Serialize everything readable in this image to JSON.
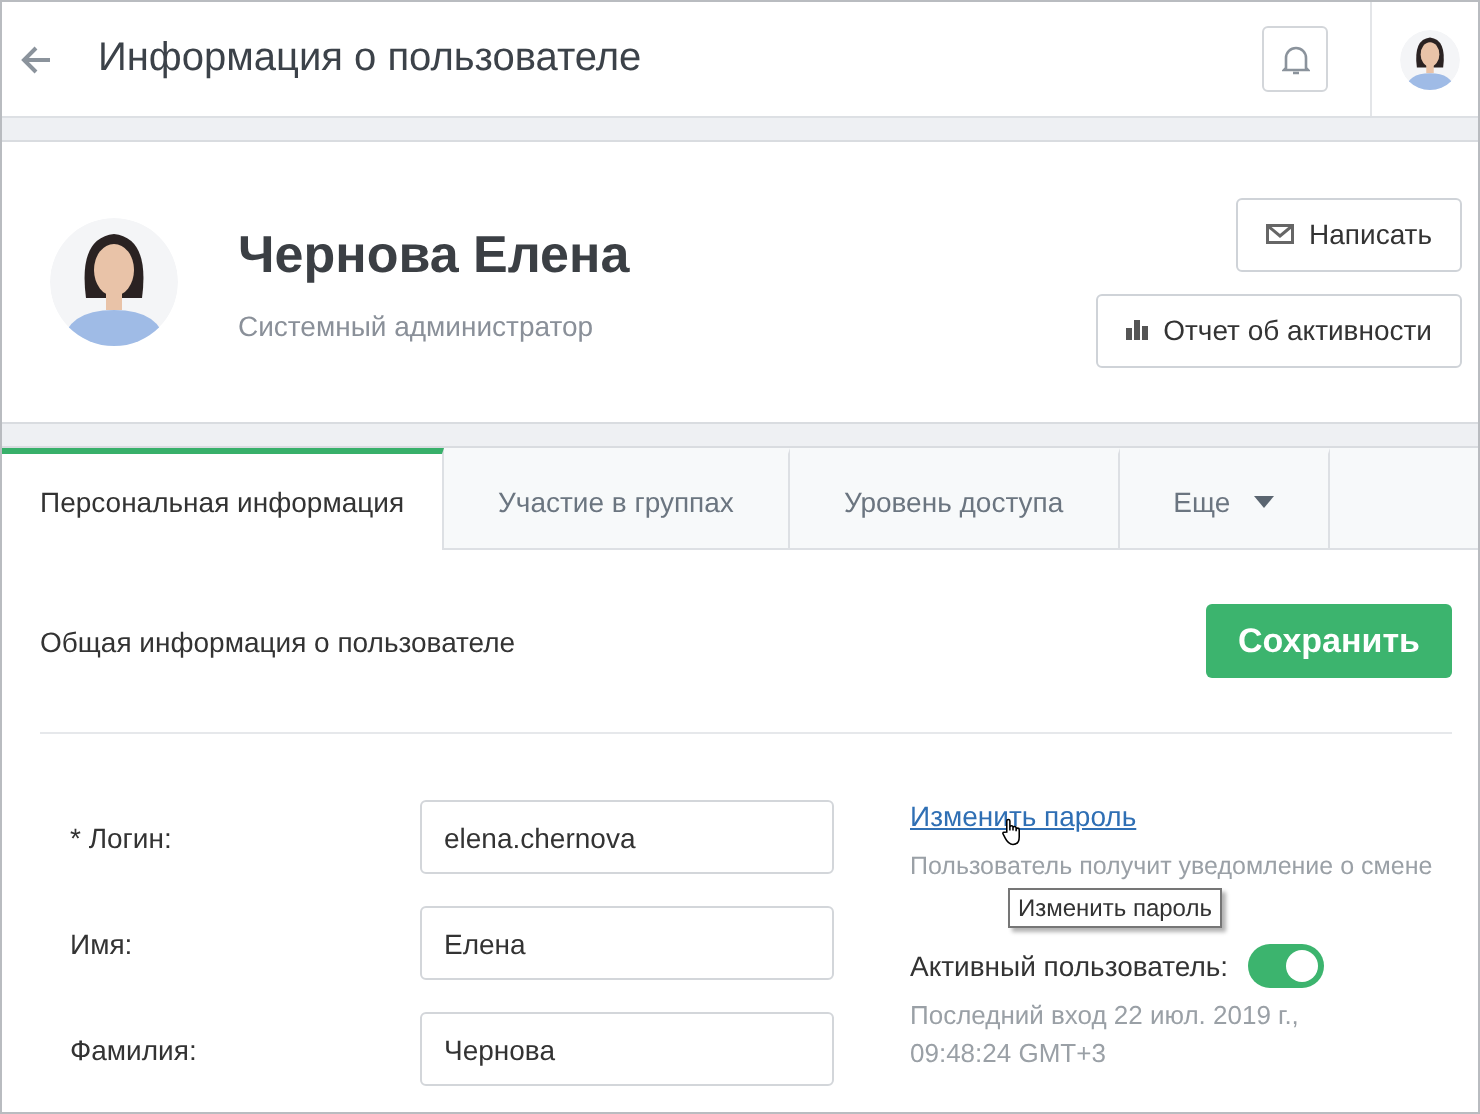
{
  "header": {
    "title": "Информация о пользователе"
  },
  "profile": {
    "name": "Чернова Елена",
    "role": "Системный администратор",
    "buttons": [
      {
        "kind": "mail",
        "label": "Написать"
      },
      {
        "kind": "chart",
        "label": "Отчет об активности"
      }
    ]
  },
  "tabs": [
    {
      "label": "Персональная информация",
      "selected": true,
      "kind": "tab"
    },
    {
      "label": "Участие в группах",
      "selected": false,
      "kind": "tab"
    },
    {
      "label": "Уровень доступа",
      "selected": false,
      "kind": "tab"
    },
    {
      "label": "Еще",
      "selected": false,
      "kind": "menu"
    }
  ],
  "section": {
    "title": "Общая информация о пользователе",
    "save_button": "Сохранить"
  },
  "fields": [
    {
      "label": "* Логин:",
      "value": "elena.chernova"
    },
    {
      "label": "Имя:",
      "value": "Елена"
    },
    {
      "label": "Фамилия:",
      "value": "Чернова"
    }
  ],
  "password": {
    "link": "Изменить пароль",
    "hint": "Пользователь получит уведомление о смене",
    "tooltip": "Изменить пароль"
  },
  "active": {
    "label": "Активный пользователь:",
    "on": true,
    "last_login": "Последний вход 22 июл. 2019 г., 09:48:24 GMT+3"
  }
}
